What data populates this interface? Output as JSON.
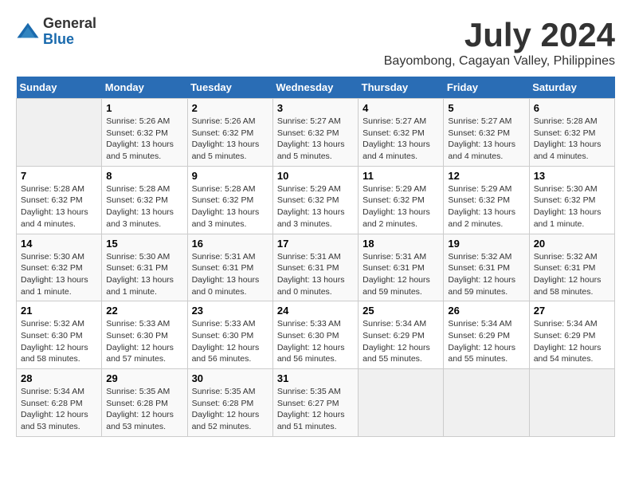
{
  "logo": {
    "general": "General",
    "blue": "Blue"
  },
  "title": {
    "month": "July 2024",
    "location": "Bayombong, Cagayan Valley, Philippines"
  },
  "headers": [
    "Sunday",
    "Monday",
    "Tuesday",
    "Wednesday",
    "Thursday",
    "Friday",
    "Saturday"
  ],
  "weeks": [
    [
      {
        "day": "",
        "info": ""
      },
      {
        "day": "1",
        "info": "Sunrise: 5:26 AM\nSunset: 6:32 PM\nDaylight: 13 hours\nand 5 minutes."
      },
      {
        "day": "2",
        "info": "Sunrise: 5:26 AM\nSunset: 6:32 PM\nDaylight: 13 hours\nand 5 minutes."
      },
      {
        "day": "3",
        "info": "Sunrise: 5:27 AM\nSunset: 6:32 PM\nDaylight: 13 hours\nand 5 minutes."
      },
      {
        "day": "4",
        "info": "Sunrise: 5:27 AM\nSunset: 6:32 PM\nDaylight: 13 hours\nand 4 minutes."
      },
      {
        "day": "5",
        "info": "Sunrise: 5:27 AM\nSunset: 6:32 PM\nDaylight: 13 hours\nand 4 minutes."
      },
      {
        "day": "6",
        "info": "Sunrise: 5:28 AM\nSunset: 6:32 PM\nDaylight: 13 hours\nand 4 minutes."
      }
    ],
    [
      {
        "day": "7",
        "info": "Sunrise: 5:28 AM\nSunset: 6:32 PM\nDaylight: 13 hours\nand 4 minutes."
      },
      {
        "day": "8",
        "info": "Sunrise: 5:28 AM\nSunset: 6:32 PM\nDaylight: 13 hours\nand 3 minutes."
      },
      {
        "day": "9",
        "info": "Sunrise: 5:28 AM\nSunset: 6:32 PM\nDaylight: 13 hours\nand 3 minutes."
      },
      {
        "day": "10",
        "info": "Sunrise: 5:29 AM\nSunset: 6:32 PM\nDaylight: 13 hours\nand 3 minutes."
      },
      {
        "day": "11",
        "info": "Sunrise: 5:29 AM\nSunset: 6:32 PM\nDaylight: 13 hours\nand 2 minutes."
      },
      {
        "day": "12",
        "info": "Sunrise: 5:29 AM\nSunset: 6:32 PM\nDaylight: 13 hours\nand 2 minutes."
      },
      {
        "day": "13",
        "info": "Sunrise: 5:30 AM\nSunset: 6:32 PM\nDaylight: 13 hours\nand 1 minute."
      }
    ],
    [
      {
        "day": "14",
        "info": "Sunrise: 5:30 AM\nSunset: 6:32 PM\nDaylight: 13 hours\nand 1 minute."
      },
      {
        "day": "15",
        "info": "Sunrise: 5:30 AM\nSunset: 6:31 PM\nDaylight: 13 hours\nand 1 minute."
      },
      {
        "day": "16",
        "info": "Sunrise: 5:31 AM\nSunset: 6:31 PM\nDaylight: 13 hours\nand 0 minutes."
      },
      {
        "day": "17",
        "info": "Sunrise: 5:31 AM\nSunset: 6:31 PM\nDaylight: 13 hours\nand 0 minutes."
      },
      {
        "day": "18",
        "info": "Sunrise: 5:31 AM\nSunset: 6:31 PM\nDaylight: 12 hours\nand 59 minutes."
      },
      {
        "day": "19",
        "info": "Sunrise: 5:32 AM\nSunset: 6:31 PM\nDaylight: 12 hours\nand 59 minutes."
      },
      {
        "day": "20",
        "info": "Sunrise: 5:32 AM\nSunset: 6:31 PM\nDaylight: 12 hours\nand 58 minutes."
      }
    ],
    [
      {
        "day": "21",
        "info": "Sunrise: 5:32 AM\nSunset: 6:30 PM\nDaylight: 12 hours\nand 58 minutes."
      },
      {
        "day": "22",
        "info": "Sunrise: 5:33 AM\nSunset: 6:30 PM\nDaylight: 12 hours\nand 57 minutes."
      },
      {
        "day": "23",
        "info": "Sunrise: 5:33 AM\nSunset: 6:30 PM\nDaylight: 12 hours\nand 56 minutes."
      },
      {
        "day": "24",
        "info": "Sunrise: 5:33 AM\nSunset: 6:30 PM\nDaylight: 12 hours\nand 56 minutes."
      },
      {
        "day": "25",
        "info": "Sunrise: 5:34 AM\nSunset: 6:29 PM\nDaylight: 12 hours\nand 55 minutes."
      },
      {
        "day": "26",
        "info": "Sunrise: 5:34 AM\nSunset: 6:29 PM\nDaylight: 12 hours\nand 55 minutes."
      },
      {
        "day": "27",
        "info": "Sunrise: 5:34 AM\nSunset: 6:29 PM\nDaylight: 12 hours\nand 54 minutes."
      }
    ],
    [
      {
        "day": "28",
        "info": "Sunrise: 5:34 AM\nSunset: 6:28 PM\nDaylight: 12 hours\nand 53 minutes."
      },
      {
        "day": "29",
        "info": "Sunrise: 5:35 AM\nSunset: 6:28 PM\nDaylight: 12 hours\nand 53 minutes."
      },
      {
        "day": "30",
        "info": "Sunrise: 5:35 AM\nSunset: 6:28 PM\nDaylight: 12 hours\nand 52 minutes."
      },
      {
        "day": "31",
        "info": "Sunrise: 5:35 AM\nSunset: 6:27 PM\nDaylight: 12 hours\nand 51 minutes."
      },
      {
        "day": "",
        "info": ""
      },
      {
        "day": "",
        "info": ""
      },
      {
        "day": "",
        "info": ""
      }
    ]
  ]
}
